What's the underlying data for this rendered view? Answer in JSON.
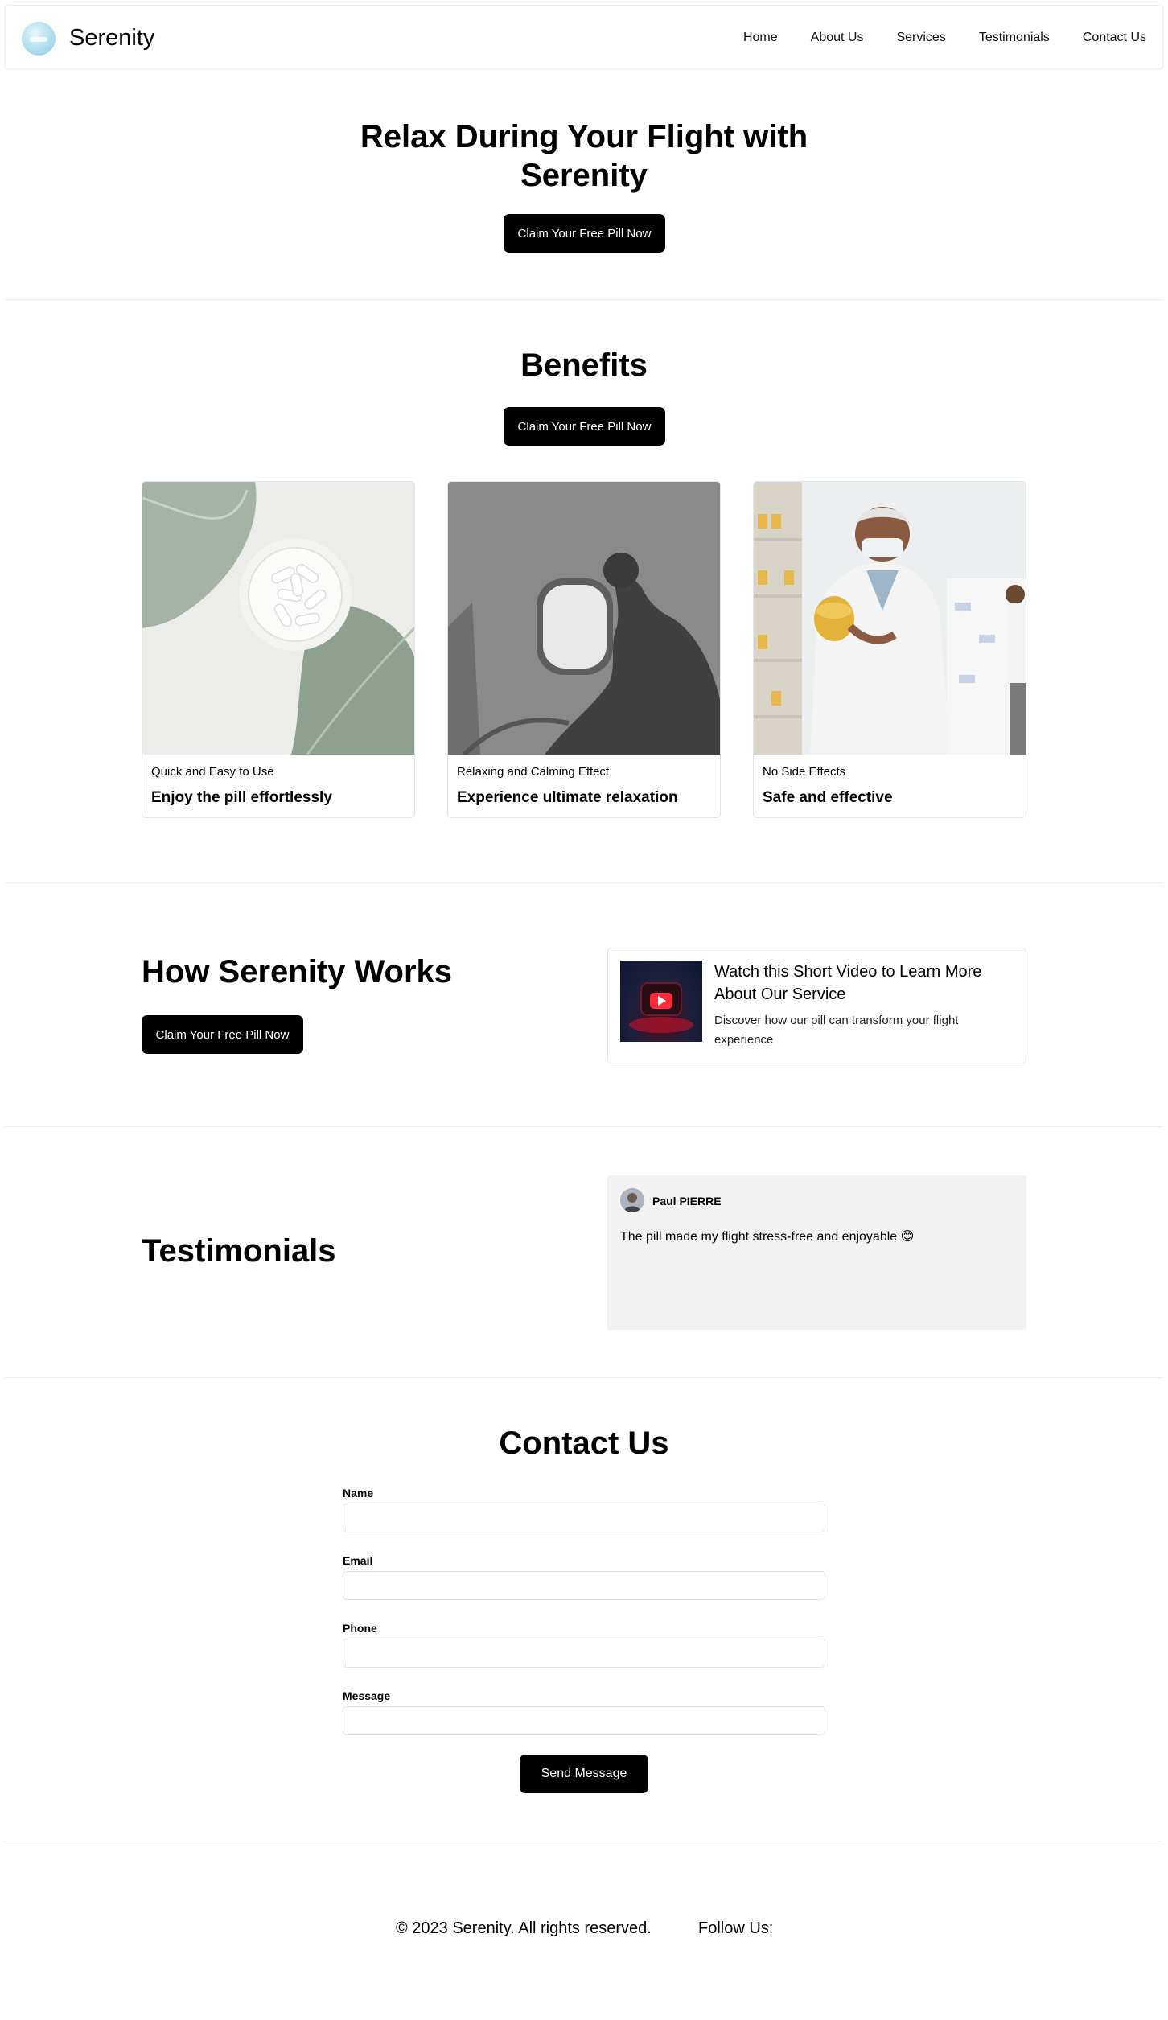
{
  "header": {
    "brand": "Serenity",
    "logo_icon": "logo-icon",
    "nav": [
      "Home",
      "About Us",
      "Services",
      "Testimonials",
      "Contact Us"
    ]
  },
  "hero": {
    "title": "Relax During Your Flight with Serenity",
    "cta": "Claim Your Free Pill Now"
  },
  "benefits": {
    "title": "Benefits",
    "cta": "Claim Your Free Pill Now",
    "cards": [
      {
        "subtitle": "Quick and Easy to Use",
        "heading": "Enjoy the pill effortlessly"
      },
      {
        "subtitle": "Relaxing and Calming Effect",
        "heading": "Experience ultimate relaxation"
      },
      {
        "subtitle": "No Side Effects",
        "heading": "Safe and effective"
      }
    ]
  },
  "how": {
    "title": "How Serenity Works",
    "cta": "Claim Your Free Pill Now",
    "video": {
      "icon": "play-icon",
      "title": "Watch this Short Video to Learn More About Our Service",
      "description": "Discover how our pill can transform your flight experience"
    }
  },
  "testimonials": {
    "title": "Testimonials",
    "items": [
      {
        "name": "Paul PIERRE",
        "text": "The pill made my flight stress-free and enjoyable 😊"
      }
    ]
  },
  "contact": {
    "title": "Contact Us",
    "fields": [
      {
        "label": "Name",
        "value": "",
        "placeholder": ""
      },
      {
        "label": "Email",
        "value": "",
        "placeholder": ""
      },
      {
        "label": "Phone",
        "value": "",
        "placeholder": ""
      },
      {
        "label": "Message",
        "value": "",
        "placeholder": ""
      }
    ],
    "submit": "Send Message"
  },
  "footer": {
    "copyright": "© 2023 Serenity. All rights reserved.",
    "follow": "Follow Us:"
  },
  "colors": {
    "button": "#000000",
    "testimonial_bg": "#f2f2f2",
    "border": "#e4e4e4"
  }
}
